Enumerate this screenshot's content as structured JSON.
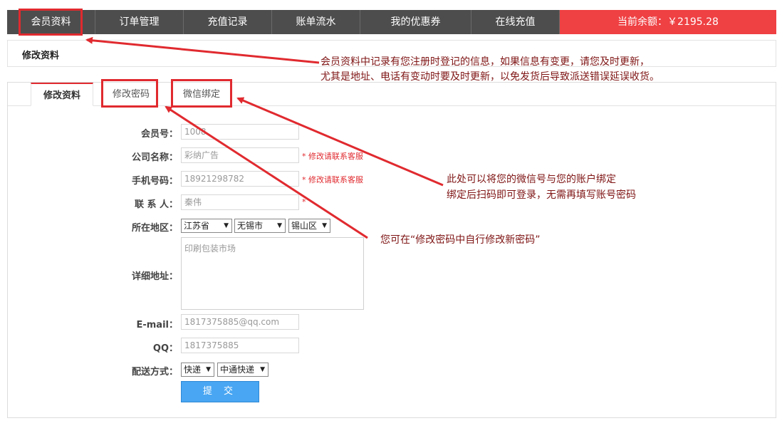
{
  "topnav": {
    "items": [
      "会员资料",
      "订单管理",
      "充值记录",
      "账单流水",
      "我的优惠券",
      "在线充值"
    ],
    "balance": "当前余额：￥2195.28"
  },
  "subhead": {
    "label": "修改资料"
  },
  "notes": {
    "profile_line1": "会员资料中记录有您注册时登记的信息，如果信息有变更，请您及时更新，",
    "profile_line2": "尤其是地址、电话有变动时要及时更新，以免发货后导致派送错误延误收货。",
    "wechat_line1": "此处可以将您的微信号与您的账户绑定",
    "wechat_line2": "绑定后扫码即可登录，无需再填写账号密码",
    "password": "您可在“修改密码中自行修改新密码”"
  },
  "tabs": [
    "修改资料",
    "修改密码",
    "微信绑定"
  ],
  "form": {
    "member_no_label": "会员号：",
    "member_no": "1008",
    "company_label": "公司名称：",
    "company": "彩纳广告",
    "company_hint": "* 修改请联系客服",
    "phone_label": "手机号码：",
    "phone": "18921298782",
    "phone_hint": "* 修改请联系客服",
    "contact_label": "联 系 人：",
    "contact": "秦伟",
    "contact_hint": "*",
    "region_label": "所在地区：",
    "province": "江苏省",
    "city": "无锡市",
    "district": "锡山区",
    "address_label": "详细地址：",
    "address": "印刷包装市场",
    "email_label": "E-mail：",
    "email": "1817375885@qq.com",
    "qq_label": "QQ：",
    "qq": "1817375885",
    "delivery_label": "配送方式：",
    "delivery": "快递",
    "courier": "中通快递",
    "submit": "提 交"
  },
  "colors": {
    "accent_red": "#e02a2f",
    "nav_bg": "#4d4d4d",
    "balance_bg": "#ef4043",
    "submit_bg": "#48a6f3",
    "note_text": "#7f1414"
  }
}
